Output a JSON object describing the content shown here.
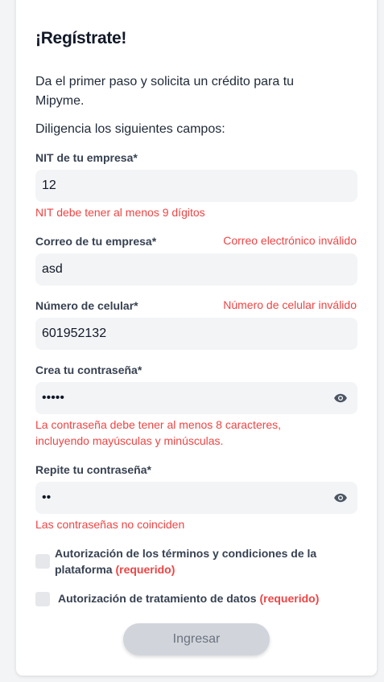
{
  "form": {
    "title": "¡Regístrate!",
    "intro": "Da el primer paso y solicita un crédito para tu Mipyme.",
    "instruction": "Diligencia los siguientes campos:",
    "nit": {
      "label": "NIT de tu empresa*",
      "value": "12",
      "error": "NIT debe tener al menos 9 dígitos"
    },
    "email": {
      "label": "Correo de tu empresa*",
      "value": "asd",
      "error": "Correo electrónico inválido"
    },
    "phone": {
      "label": "Número de celular*",
      "value": "601952132",
      "error": "Número de celular inválido"
    },
    "password": {
      "label": "Crea tu contraseña*",
      "value": "•••••",
      "error": "La contraseña debe tener al menos 8 caracteres, incluyendo mayúsculas y minúsculas."
    },
    "confirm": {
      "label": "Repite tu contraseña*",
      "value": "••",
      "error": "Las contraseñas no coinciden"
    },
    "terms": {
      "label": "Autorización de los términos y condiciones de la plataforma",
      "required": "(requerido)",
      "checked": false
    },
    "data_policy": {
      "label": "Autorización de tratamiento de datos",
      "required": "(requerido)",
      "checked": false
    },
    "submit_label": "Ingresar"
  },
  "colors": {
    "error": "#ef4444",
    "field_bg": "#f3f4f6",
    "button_disabled": "#d1d5db"
  },
  "icons": {
    "password_toggle": "eye-icon"
  }
}
